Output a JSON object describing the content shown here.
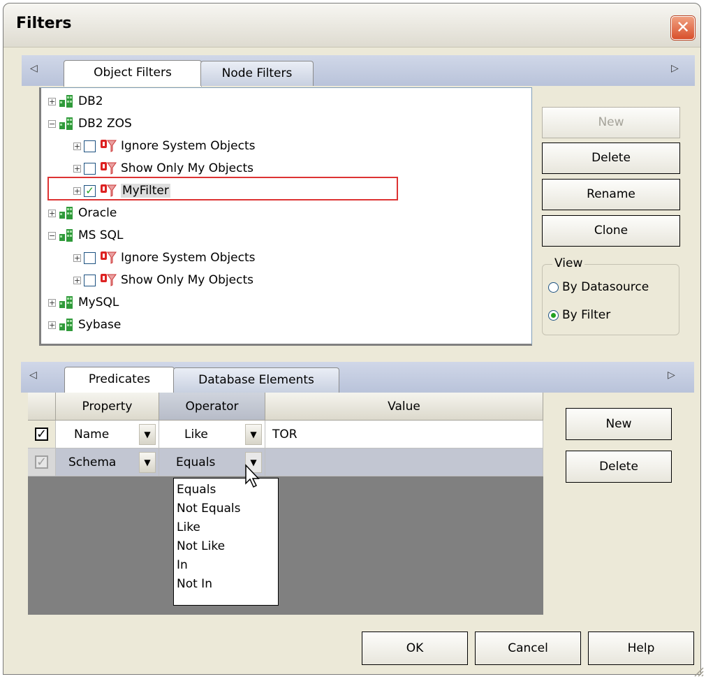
{
  "window": {
    "title": "Filters",
    "close_glyph": "✕"
  },
  "upper_tabs": {
    "left_arrow": "◁",
    "right_arrow": "▷",
    "items": [
      {
        "label": "Object Filters",
        "active": true
      },
      {
        "label": "Node Filters",
        "active": false
      }
    ]
  },
  "tree": {
    "rows": [
      {
        "type": "datasource",
        "label": "DB2",
        "expander": "+",
        "level": 0
      },
      {
        "type": "datasource",
        "label": "DB2 ZOS",
        "expander": "−",
        "level": 0
      },
      {
        "type": "filter",
        "label": "Ignore System Objects",
        "expander": "+",
        "checked": false,
        "level": 1
      },
      {
        "type": "filter",
        "label": "Show Only My Objects",
        "expander": "+",
        "checked": false,
        "level": 1
      },
      {
        "type": "filter",
        "label": "MyFilter",
        "expander": "+",
        "checked": true,
        "level": 1,
        "selected": true
      },
      {
        "type": "datasource",
        "label": "Oracle",
        "expander": "+",
        "level": 0
      },
      {
        "type": "datasource",
        "label": "MS SQL",
        "expander": "−",
        "level": 0
      },
      {
        "type": "filter",
        "label": "Ignore System Objects",
        "expander": "+",
        "checked": false,
        "level": 1
      },
      {
        "type": "filter",
        "label": "Show Only My Objects",
        "expander": "+",
        "checked": false,
        "level": 1
      },
      {
        "type": "datasource",
        "label": "MySQL",
        "expander": "+",
        "level": 0
      },
      {
        "type": "datasource",
        "label": "Sybase",
        "expander": "+",
        "level": 0
      }
    ]
  },
  "filter_buttons": {
    "new": "New",
    "delete": "Delete",
    "rename": "Rename",
    "clone": "Clone"
  },
  "view_group": {
    "legend": "View",
    "options": [
      {
        "label": "By Datasource",
        "selected": false
      },
      {
        "label": "By Filter",
        "selected": true
      }
    ]
  },
  "lower_tabs": {
    "left_arrow": "◁",
    "right_arrow": "▷",
    "items": [
      {
        "label": "Predicates",
        "active": true
      },
      {
        "label": "Database Elements",
        "active": false
      }
    ]
  },
  "predicates": {
    "headers": {
      "property": "Property",
      "operator": "Operator",
      "value": "Value"
    },
    "rows": [
      {
        "checked": true,
        "property": "Name",
        "operator": "Like",
        "value": "TOR"
      },
      {
        "checked": true,
        "property": "Schema",
        "operator": "Equals",
        "value": ""
      }
    ],
    "operator_options": [
      "Equals",
      "Not Equals",
      "Like",
      "Not Like",
      "In",
      "Not In"
    ]
  },
  "predicate_buttons": {
    "new": "New",
    "delete": "Delete"
  },
  "footer_buttons": {
    "ok": "OK",
    "cancel": "Cancel",
    "help": "Help"
  },
  "colors": {
    "tab_strip": "#b9c3da",
    "selection_outline": "#dd3333",
    "check_green": "#21a121",
    "close_red": "#d8502c"
  }
}
